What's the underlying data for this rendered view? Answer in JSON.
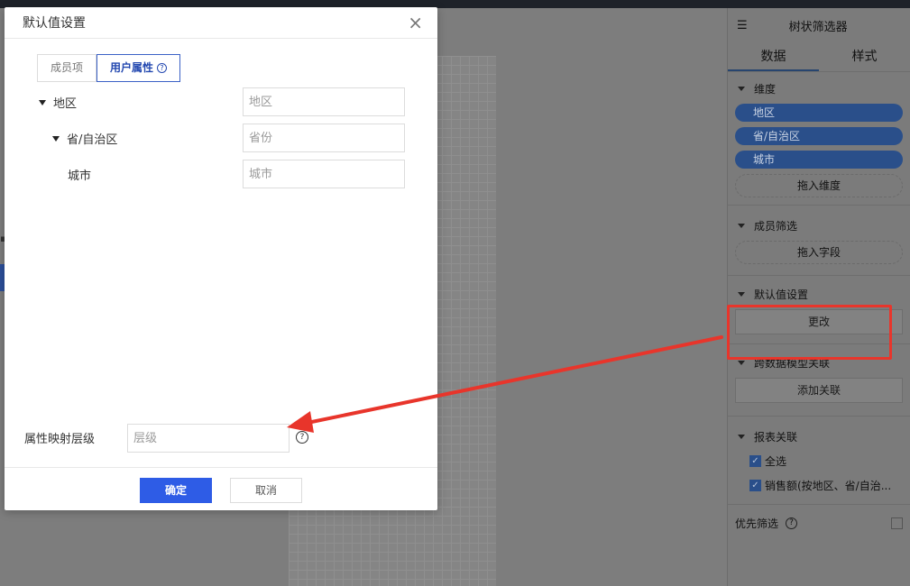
{
  "modal": {
    "title": "默认值设置",
    "close_icon": "×",
    "tabs": [
      {
        "label": "成员项",
        "active": false
      },
      {
        "label": "用户属性",
        "active": true
      }
    ],
    "tree": [
      {
        "label": "地区",
        "expanded": true,
        "placeholder": "地区"
      },
      {
        "label": "省/自治区",
        "expanded": true,
        "placeholder": "省份"
      },
      {
        "label": "城市",
        "expanded": false,
        "placeholder": "城市"
      }
    ],
    "mapping_label": "属性映射层级",
    "mapping_placeholder": "层级",
    "help_glyph": "?",
    "ok_label": "确定",
    "cancel_label": "取消"
  },
  "panel": {
    "title": "树状筛选器",
    "tabs": [
      "数据",
      "样式"
    ],
    "dimension": {
      "title": "维度",
      "fields": [
        "地区",
        "省/自治区",
        "城市"
      ],
      "drop_hint": "拖入维度"
    },
    "member_filter": {
      "title": "成员筛选",
      "drop_hint": "拖入字段"
    },
    "default_value": {
      "title": "默认值设置",
      "button": "更改"
    },
    "cross_model": {
      "title": "跨数据模型关联",
      "button": "添加关联"
    },
    "report_link": {
      "title": "报表关联",
      "items": [
        {
          "label": "全选",
          "checked": true
        },
        {
          "label": "销售额(按地区、省/自治...",
          "checked": true
        }
      ]
    },
    "priority": {
      "label": "优先筛选",
      "checked": false
    }
  },
  "colors": {
    "primary": "#2e5ce6",
    "highlight": "#e8352b",
    "tab_active": "#2348b0"
  }
}
